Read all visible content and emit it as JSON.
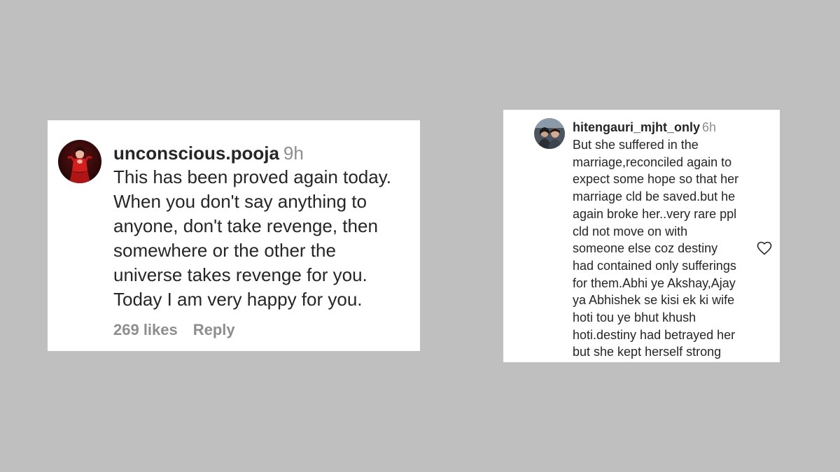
{
  "comments": [
    {
      "username": "unconscious.pooja",
      "time": "9h",
      "text": "This has been proved again today.\nWhen you don't say anything to\nanyone, don't take revenge, then\nsomewhere or the other the\nuniverse takes revenge for you.\nToday I am very happy for you.",
      "likes_label": "269 likes",
      "reply_label": "Reply",
      "avatar_icon": "profile-avatar-red-outfit"
    },
    {
      "username": "hitengauri_mjht_only",
      "time": "6h",
      "text": "But she suffered in the\nmarriage,reconciled again to\nexpect some hope so that her\nmarriage cld be saved.but he\nagain broke her..very rare ppl\ncld not move on with\nsomeone else coz destiny\nhad contained only sufferings\nfor them.Abhi ye Akshay,Ajay\nya Abhishek se kisi ek ki wife\nhoti tou ye bhut khush\nhoti.destiny had betrayed her\nbut she kept herself strong",
      "like_icon": "heart-outline-icon",
      "avatar_icon": "profile-avatar-couple"
    }
  ],
  "colors": {
    "background": "#bfbfbf",
    "card": "#ffffff",
    "text": "#262626",
    "muted": "#8e8e8e"
  }
}
